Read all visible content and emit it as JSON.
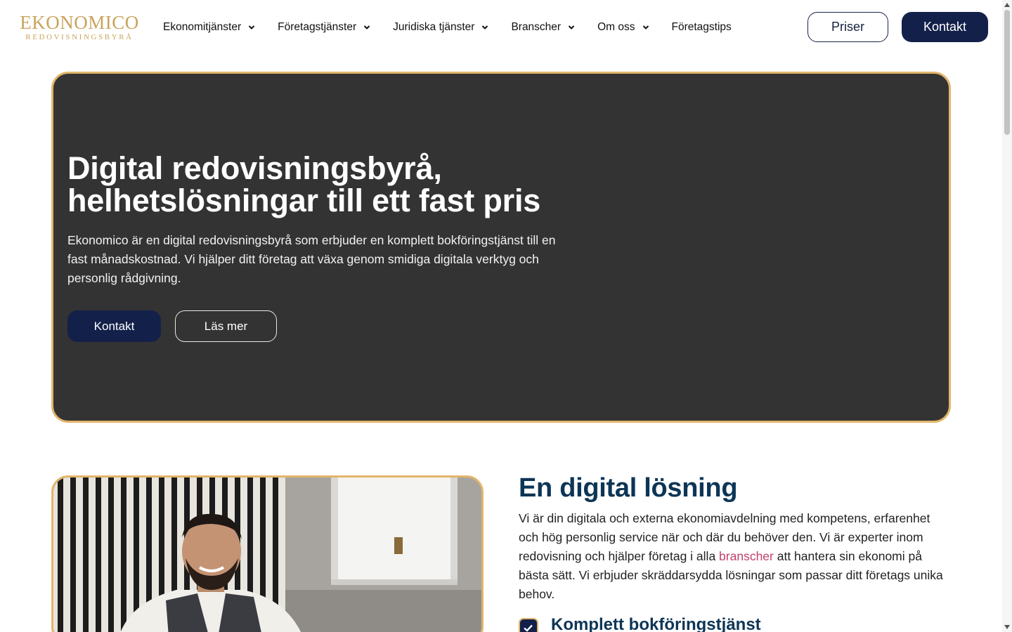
{
  "header": {
    "logo_main": "EKONOMICO",
    "logo_sub": "REDOVISNINGSBYRÅ",
    "nav": [
      {
        "label": "Ekonomitjänster",
        "dropdown": true
      },
      {
        "label": "Företagstjänster",
        "dropdown": true
      },
      {
        "label": "Juridiska tjänster",
        "dropdown": true
      },
      {
        "label": "Branscher",
        "dropdown": true
      },
      {
        "label": "Om oss",
        "dropdown": true
      },
      {
        "label": "Företagstips",
        "dropdown": false
      }
    ],
    "priser_label": "Priser",
    "kontakt_label": "Kontakt"
  },
  "hero": {
    "title_line1": "Digital redovisningsbyrå,",
    "title_line2": "helhetslösningar till ett fast pris",
    "description": "Ekonomico är en digital redovisningsbyrå som erbjuder en komplett bokföringstjänst till en fast månadskostnad. Vi hjälper ditt företag att växa genom smidiga digitala verktyg och personlig rådgivning.",
    "primary_button": "Kontakt",
    "secondary_button": "Läs mer"
  },
  "section": {
    "title": "En digital lösning",
    "text_before_link": "Vi är din digitala och externa ekonomiavdelning med kompetens, erfarenhet och hög personlig service när och där du behöver den. Vi är experter inom redovisning och hjälper företag i alla ",
    "link_text": "branscher",
    "text_after_link": " att hantera sin ekonomi på bästa sätt. Vi erbjuder skräddarsydda lösningar som passar ditt företags unika behov.",
    "feature_title": "Komplett bokföringstjänst"
  },
  "colors": {
    "navy": "#13204a",
    "gold": "#e2b56a",
    "hero_bg": "#333333",
    "heading_blue": "#0d3556",
    "link_pink": "#c2416f"
  }
}
